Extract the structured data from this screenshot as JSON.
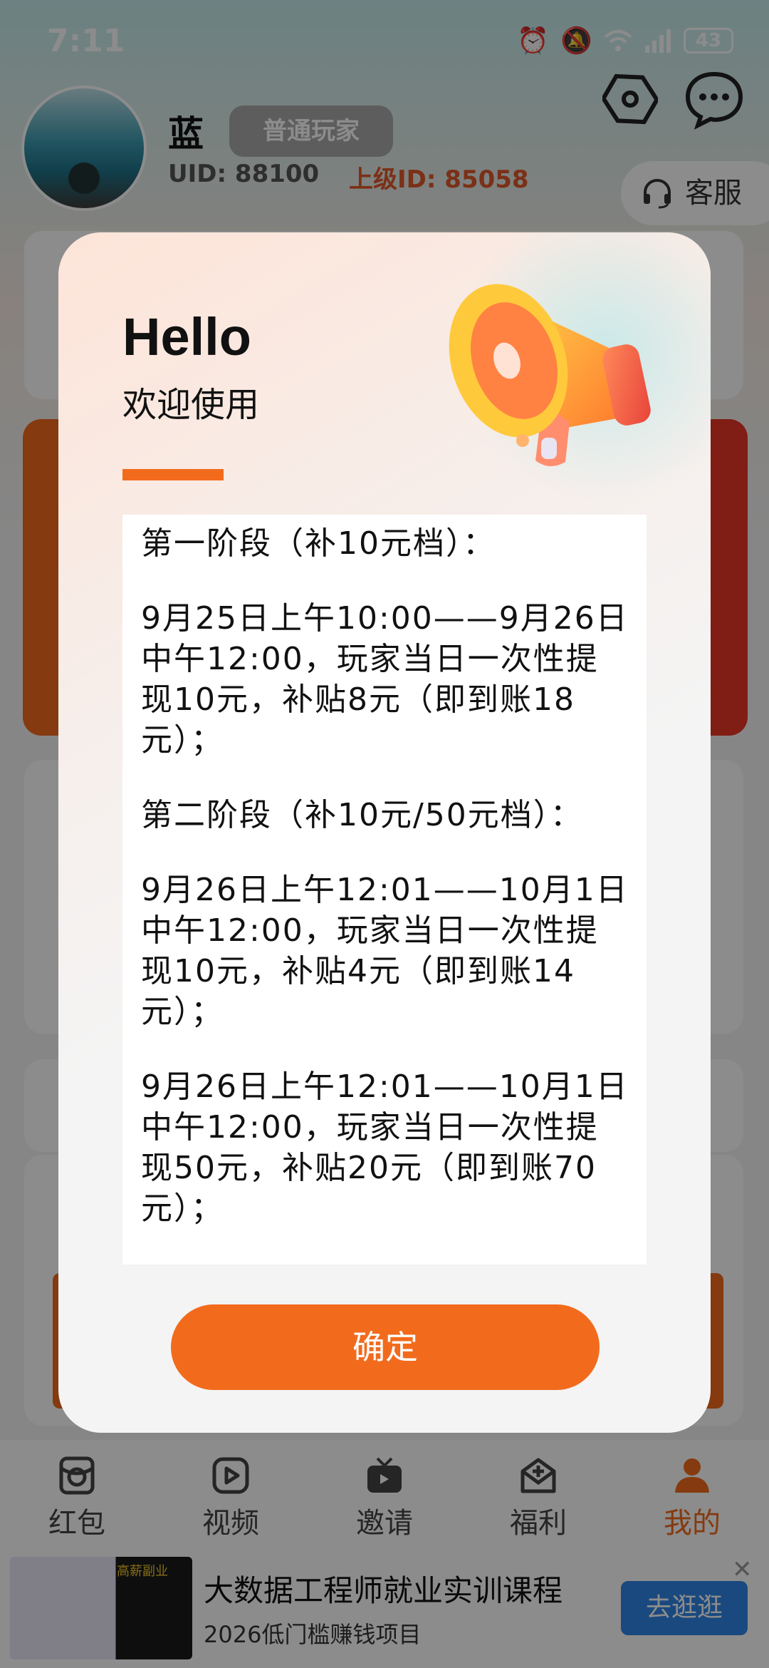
{
  "status_bar": {
    "time": "7:11",
    "battery": "43"
  },
  "profile": {
    "nickname": "蓝",
    "level_badge": "普通玩家",
    "uid": "UID: 88100",
    "parent_id": "上级ID: 85058",
    "service_label": "客服"
  },
  "dialog": {
    "hello": "Hello",
    "welcome": "欢迎使用",
    "paragraphs": [
      "第一阶段（补10元档）：",
      "9月25日上午10:00——9月26日中午12:00，玩家当日一次性提现10元，补贴8元（即到账18元）；",
      "第二阶段（补10元/50元档）：",
      "9月26日上午12:01——10月1日中午12:00，玩家当日一次性提现10元，补贴4元（即到账14元）；",
      "9月26日上午12:01——10月1日中午12:00，玩家当日一次性提现50元，补贴20元（即到账70元）；"
    ],
    "confirm": "确定"
  },
  "tabbar": {
    "items": [
      {
        "label": "红包",
        "icon": "red-packet-icon"
      },
      {
        "label": "视频",
        "icon": "video-icon"
      },
      {
        "label": "邀请",
        "icon": "invite-icon"
      },
      {
        "label": "福利",
        "icon": "gift-icon"
      },
      {
        "label": "我的",
        "icon": "profile-icon",
        "active": true
      }
    ]
  },
  "ad": {
    "thumb_tag": "高薪副业",
    "title": "大数据工程师就业实训课程",
    "subtitle": "2026低门槛赚钱项目",
    "button": "去逛逛"
  },
  "colors": {
    "accent": "#f26b1d",
    "parent_id": "#e0582a",
    "ad_button": "#2f86e8"
  }
}
